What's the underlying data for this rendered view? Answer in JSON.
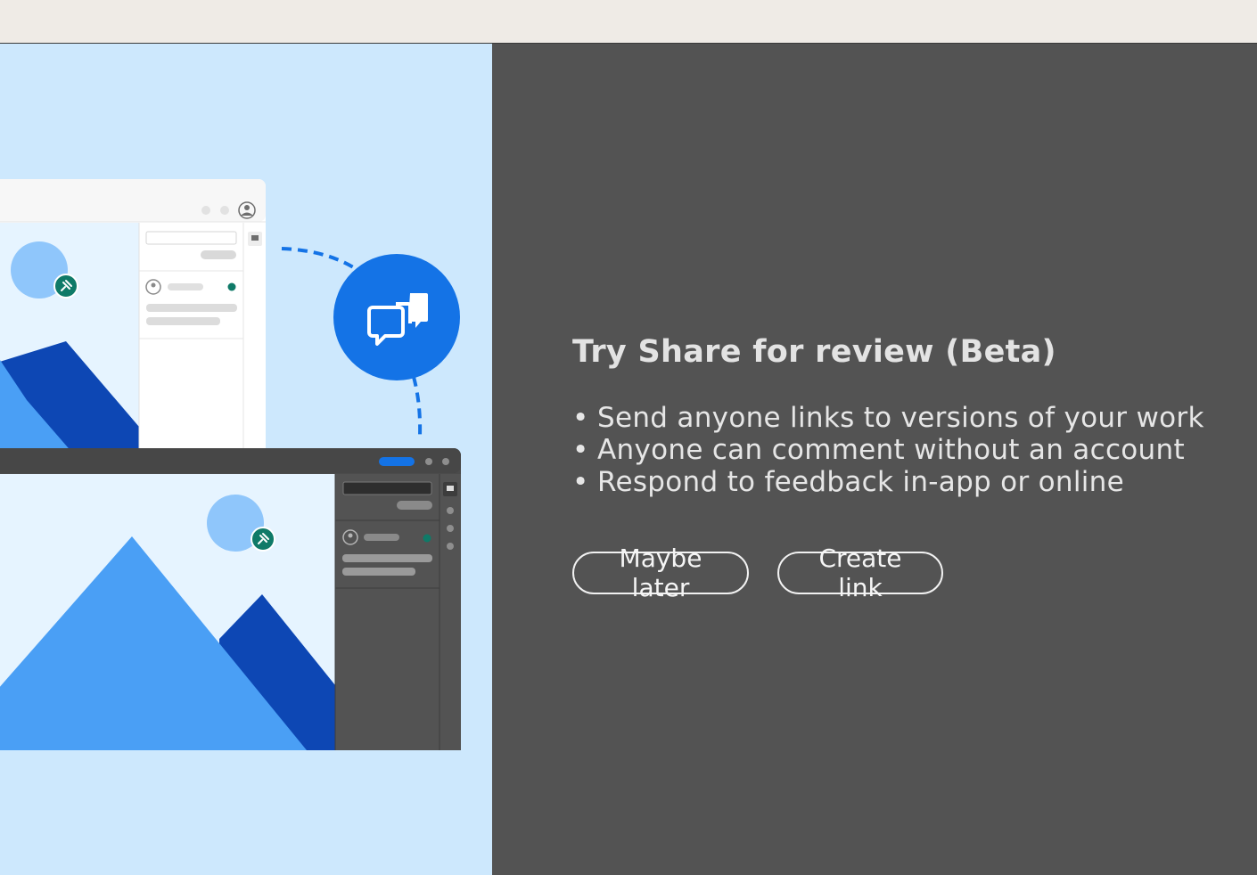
{
  "dialog": {
    "title": "Try Share for review (Beta)",
    "bullets": [
      "Send anyone links to versions of your work",
      "Anyone can comment without an account",
      "Respond to feedback in-app or online"
    ],
    "buttons": {
      "maybe_later": "Maybe later",
      "create_link": "Create link"
    }
  },
  "illustration": {
    "icons": [
      "comment-bubbles-icon",
      "pin-icon",
      "user-avatar-icon",
      "comment-icon"
    ],
    "colors": {
      "background": "#cde8fd",
      "accent_blue": "#1473e6",
      "mountain_light": "#4a9ff5",
      "mountain_dark": "#0d47b4",
      "pin_green": "#0f7a68",
      "panel_dark": "#535353"
    }
  }
}
